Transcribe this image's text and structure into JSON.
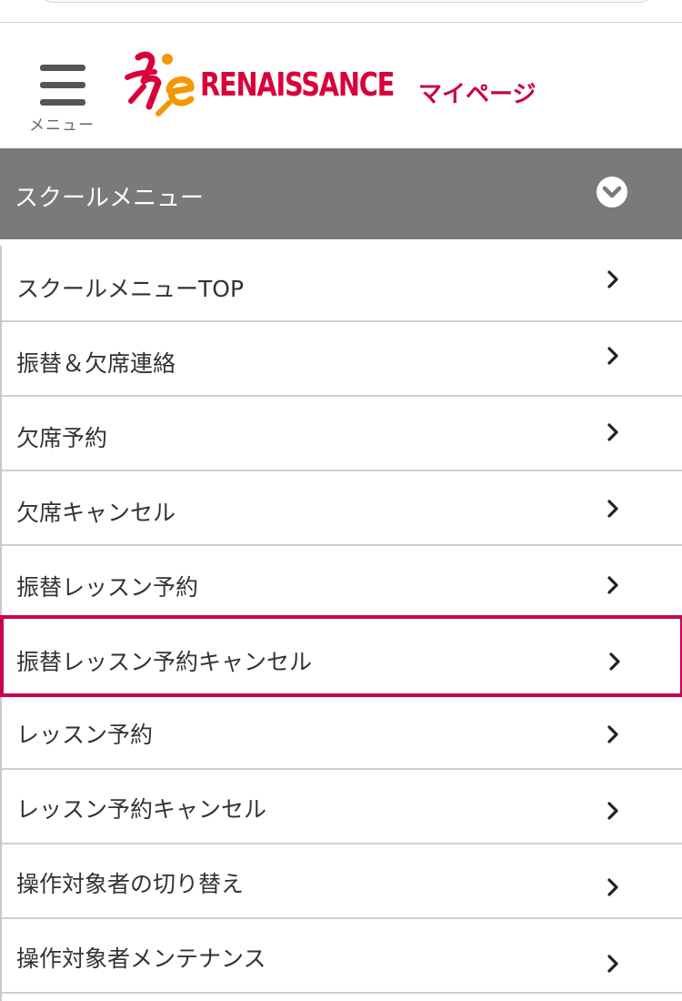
{
  "header": {
    "menu_label": "メニュー",
    "logo_text": "RENAISSANCE",
    "mypage_label": "マイページ"
  },
  "school_menu": {
    "title": "スクールメニュー",
    "expanded": true
  },
  "menu_items": [
    {
      "label": "スクールメニューTOP"
    },
    {
      "label": "振替＆欠席連絡"
    },
    {
      "label": "欠席予約"
    },
    {
      "label": "欠席キャンセル"
    },
    {
      "label": "振替レッスン予約"
    },
    {
      "label": "振替レッスン予約キャンセル",
      "highlighted": true
    },
    {
      "label": "レッスン予約"
    },
    {
      "label": "レッスン予約キャンセル"
    },
    {
      "label": "操作対象者の切り替え"
    },
    {
      "label": "操作対象者メンテナンス"
    }
  ],
  "colors": {
    "brand_red": "#d9003b",
    "accent_magenta": "#c8004f",
    "bar_gray": "#7a7a7a",
    "logo_orange": "#f39800"
  },
  "icons": {
    "menu": "hamburger-icon",
    "toggle": "chevron-down-circle-icon",
    "item_arrow": "chevron-right-icon"
  }
}
